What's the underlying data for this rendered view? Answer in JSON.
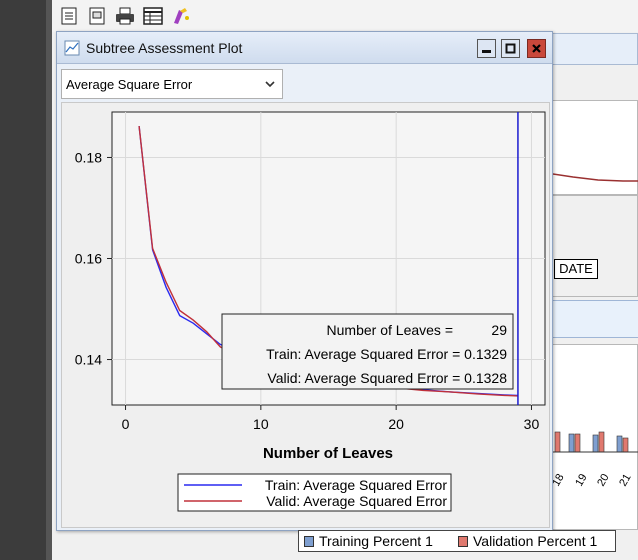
{
  "window": {
    "title": "Subtree Assessment Plot",
    "controls": [
      "minimize",
      "maximize",
      "close"
    ]
  },
  "statistic_select": {
    "value": "Average Square Error"
  },
  "tooltip": {
    "line1_label": "Number of Leaves =",
    "line1_value": "29",
    "line2": "Train: Average Squared Error = 0.1329",
    "line3": "Valid: Average Squared Error = 0.1328"
  },
  "background": {
    "date_label": "DATE",
    "legend": {
      "training": "Training Percent 1",
      "validation": "Validation Percent 1"
    },
    "colors": {
      "training": "#7f9fd0",
      "validation": "#e0796f"
    }
  },
  "colors": {
    "train": "#2a2af0",
    "valid": "#c0303a",
    "marker": "#1b1bd0"
  },
  "chart_data": {
    "type": "line",
    "xlabel": "Number of Leaves",
    "ylabel": "",
    "xlim": [
      -1,
      31
    ],
    "ylim": [
      0.131,
      0.189
    ],
    "xticks": [
      0,
      10,
      20,
      30
    ],
    "yticks": [
      0.14,
      0.16,
      0.18
    ],
    "x_tick_labels": [
      "0",
      "10",
      "20",
      "30"
    ],
    "y_tick_labels": [
      "0.14",
      "0.16",
      "0.18"
    ],
    "grid": true,
    "selected_x": 29,
    "legend_position": "bottom-center",
    "series": [
      {
        "name": "Train: Average Squared Error",
        "x": [
          1,
          2,
          3,
          4,
          5,
          6,
          7,
          8,
          9,
          10,
          12,
          14,
          16,
          18,
          20,
          22,
          24,
          26,
          28,
          29
        ],
        "values": [
          0.1862,
          0.1617,
          0.1543,
          0.1487,
          0.1472,
          0.1451,
          0.143,
          0.1418,
          0.1406,
          0.1397,
          0.1382,
          0.1367,
          0.1356,
          0.135,
          0.1345,
          0.134,
          0.1336,
          0.1333,
          0.133,
          0.1329
        ]
      },
      {
        "name": "Valid: Average Squared Error",
        "x": [
          1,
          2,
          3,
          4,
          5,
          6,
          7,
          8,
          9,
          10,
          12,
          14,
          16,
          18,
          20,
          22,
          24,
          26,
          28,
          29
        ],
        "values": [
          0.1862,
          0.162,
          0.1553,
          0.1497,
          0.1478,
          0.1455,
          0.1425,
          0.1412,
          0.1401,
          0.1393,
          0.1378,
          0.1365,
          0.1356,
          0.135,
          0.1344,
          0.1339,
          0.1336,
          0.1332,
          0.1329,
          0.1328
        ]
      }
    ]
  }
}
